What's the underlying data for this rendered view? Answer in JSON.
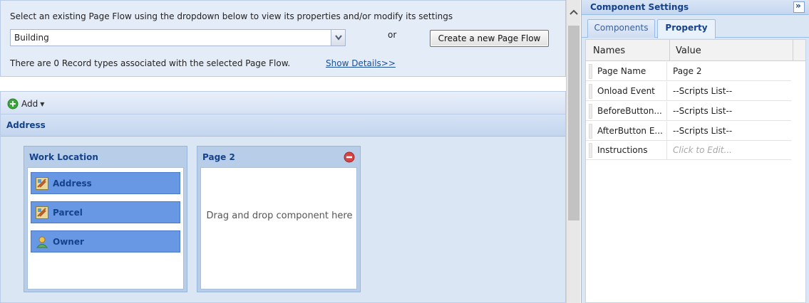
{
  "top": {
    "instruction": "Select an existing Page Flow using the dropdown below to view its properties and/or modify its settings",
    "selected_flow": "Building",
    "or_text": "or",
    "create_button": "Create a new Page Flow",
    "record_info": "There are 0 Record types associated with the selected Page Flow.",
    "show_details": "Show Details>>"
  },
  "toolbar": {
    "add_label": "Add"
  },
  "section": {
    "title": "Address"
  },
  "pages": [
    {
      "title": "Work Location",
      "components": [
        {
          "label": "Address",
          "icon": "component-icon"
        },
        {
          "label": "Parcel",
          "icon": "component-icon"
        },
        {
          "label": "Owner",
          "icon": "person-icon"
        }
      ]
    },
    {
      "title": "Page 2",
      "drop_hint": "Drag and drop component here"
    }
  ],
  "settings": {
    "title": "Component Settings",
    "collapse_glyph": "»",
    "tabs": [
      "Components",
      "Property"
    ],
    "active_tab": "Property",
    "columns": [
      "Names",
      "Value"
    ],
    "rows": [
      {
        "name": "Page Name",
        "value": "Page 2"
      },
      {
        "name": "Onload Event",
        "value": "--Scripts List--"
      },
      {
        "name": "BeforeButton...",
        "value": "--Scripts List--"
      },
      {
        "name": "AfterButton E...",
        "value": "--Scripts List--"
      },
      {
        "name": "Instructions",
        "value": "Click to Edit..."
      }
    ]
  },
  "colors": {
    "accent": "#15428b",
    "component_fill": "#6897e4",
    "remove_icon": "#d64545",
    "add_icon": "#3aa63a"
  }
}
